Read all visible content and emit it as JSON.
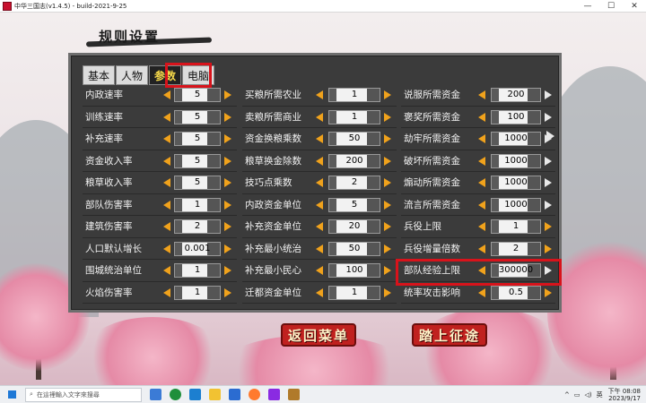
{
  "window": {
    "title": "中华三国志(v1.4.5) - build-2021-9-25",
    "controls": [
      "—",
      "☐",
      "✕"
    ]
  },
  "panel_title": "规则设置",
  "tabs": [
    {
      "label": "基本",
      "active": false
    },
    {
      "label": "人物",
      "active": false
    },
    {
      "label": "参数",
      "active": true
    },
    {
      "label": "电脑",
      "active": false
    }
  ],
  "columns": [
    {
      "rows": [
        {
          "label": "内政速率",
          "value": "5"
        },
        {
          "label": "训练速率",
          "value": "5"
        },
        {
          "label": "补充速率",
          "value": "5"
        },
        {
          "label": "资金收入率",
          "value": "5"
        },
        {
          "label": "粮草收入率",
          "value": "5"
        },
        {
          "label": "部队伤害率",
          "value": "1"
        },
        {
          "label": "建筑伤害率",
          "value": "2"
        },
        {
          "label": "人口默认增长",
          "value": "0.001"
        },
        {
          "label": "围城统治单位",
          "value": "1"
        },
        {
          "label": "火焰伤害率",
          "value": "1"
        }
      ]
    },
    {
      "rows": [
        {
          "label": "买粮所需农业",
          "value": "1"
        },
        {
          "label": "卖粮所需商业",
          "value": "1"
        },
        {
          "label": "资金换粮乘数",
          "value": "50"
        },
        {
          "label": "粮草换金除数",
          "value": "200"
        },
        {
          "label": "技巧点乘数",
          "value": "2"
        },
        {
          "label": "内政资金单位",
          "value": "5"
        },
        {
          "label": "补充资金单位",
          "value": "20"
        },
        {
          "label": "补充最小统治",
          "value": "50"
        },
        {
          "label": "补充最小民心",
          "value": "100"
        },
        {
          "label": "迁都资金单位",
          "value": "1"
        }
      ]
    },
    {
      "rows": [
        {
          "label": "说服所需资金",
          "value": "200"
        },
        {
          "label": "褒奖所需资金",
          "value": "100"
        },
        {
          "label": "劫牢所需资金",
          "value": "1000"
        },
        {
          "label": "破坏所需资金",
          "value": "1000"
        },
        {
          "label": "煽动所需资金",
          "value": "1000"
        },
        {
          "label": "流言所需资金",
          "value": "1000"
        },
        {
          "label": "兵役上限",
          "value": "1"
        },
        {
          "label": "兵役增量倍数",
          "value": "2"
        },
        {
          "label": "部队经验上限",
          "value": "300000"
        },
        {
          "label": "统率攻击影响",
          "value": "0.5"
        }
      ]
    }
  ],
  "buttons": {
    "back": "返回菜单",
    "start": "踏上征途"
  },
  "taskbar": {
    "search_placeholder": "在這裡輸入文字來搜尋",
    "ime": "英",
    "time": "下午 08:08",
    "date": "2023/9/17"
  },
  "colors": {
    "panel": "#3b3b3b",
    "arrow": "#f0a21c",
    "highlight": "#d8131b",
    "active_tab_text": "#f5d84a"
  }
}
